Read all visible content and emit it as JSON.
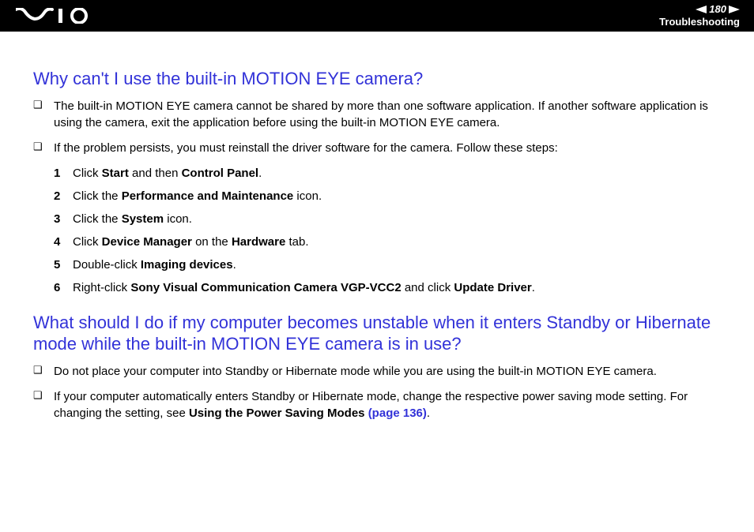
{
  "header": {
    "page_number": "180",
    "section": "Troubleshooting"
  },
  "section1": {
    "heading": "Why can't I use the built-in MOTION EYE camera?",
    "bullet1": "The built-in MOTION EYE camera cannot be shared by more than one software application. If another software application is using the camera, exit the application before using the built-in MOTION EYE camera.",
    "bullet2": "If the problem persists, you must reinstall the driver software for the camera. Follow these steps:",
    "steps": {
      "s1a": "Click ",
      "s1b": "Start",
      "s1c": " and then ",
      "s1d": "Control Panel",
      "s1e": ".",
      "s2a": "Click the ",
      "s2b": "Performance and Maintenance",
      "s2c": " icon.",
      "s3a": "Click the ",
      "s3b": "System",
      "s3c": " icon.",
      "s4a": "Click ",
      "s4b": "Device Manager",
      "s4c": " on the ",
      "s4d": "Hardware",
      "s4e": " tab.",
      "s5a": "Double-click ",
      "s5b": "Imaging devices",
      "s5c": ".",
      "s6a": "Right-click ",
      "s6b": "Sony Visual Communication Camera VGP-VCC2",
      "s6c": " and click ",
      "s6d": "Update Driver",
      "s6e": "."
    },
    "nums": {
      "n1": "1",
      "n2": "2",
      "n3": "3",
      "n4": "4",
      "n5": "5",
      "n6": "6"
    }
  },
  "section2": {
    "heading": "What should I do if my computer becomes unstable when it enters Standby or Hibernate mode while the built-in MOTION EYE camera is in use?",
    "bullet1": "Do not place your computer into Standby or Hibernate mode while you are using the built-in MOTION EYE camera.",
    "bullet2a": "If your computer automatically enters Standby or Hibernate mode, change the respective power saving mode setting. For changing the setting, see ",
    "bullet2b": "Using the Power Saving Modes ",
    "bullet2c": "(page 136)",
    "bullet2d": "."
  },
  "marker": "❑"
}
